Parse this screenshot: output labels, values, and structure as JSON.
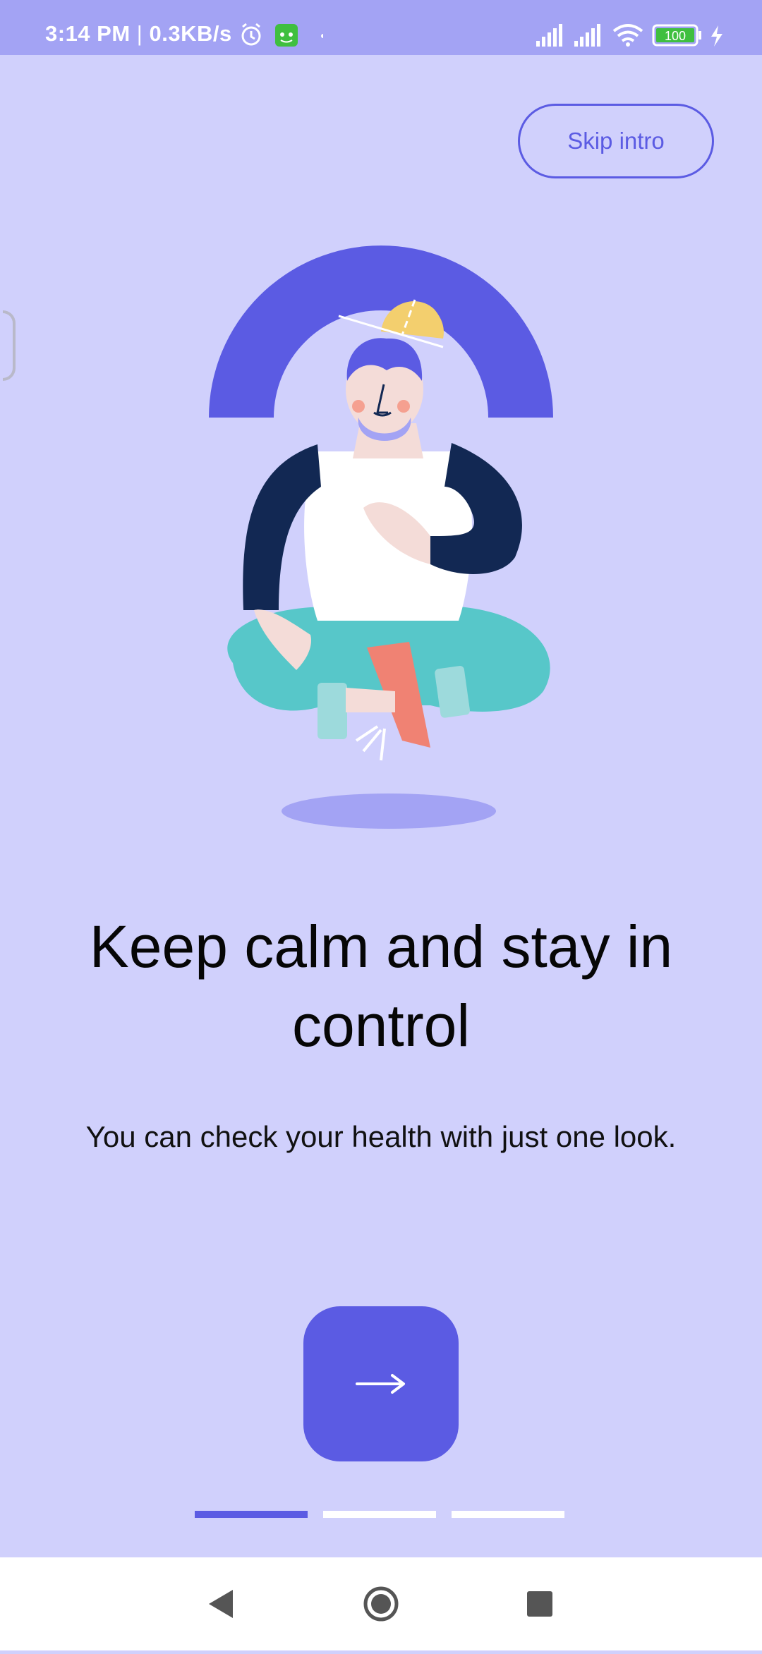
{
  "status_bar": {
    "time": "3:14 PM",
    "network_speed": "0.3KB/s",
    "battery_level": "100",
    "icons": [
      "alarm-icon",
      "app-notification-icon",
      "signal-icon",
      "signal-icon",
      "wifi-icon",
      "battery-icon",
      "charging-icon"
    ]
  },
  "onboarding": {
    "skip_label": "Skip intro",
    "title": "Keep calm and stay in control",
    "subtitle": "You can check your health with just one look.",
    "next_icon": "arrow-right-icon",
    "page_indicator": {
      "current": 1,
      "total": 3
    }
  },
  "colors": {
    "background": "#d0d0fc",
    "accent": "#5b5be3",
    "status_bar": "#a3a3f4"
  },
  "nav_bar": {
    "icons": [
      "back-icon",
      "home-icon",
      "recents-icon"
    ]
  }
}
